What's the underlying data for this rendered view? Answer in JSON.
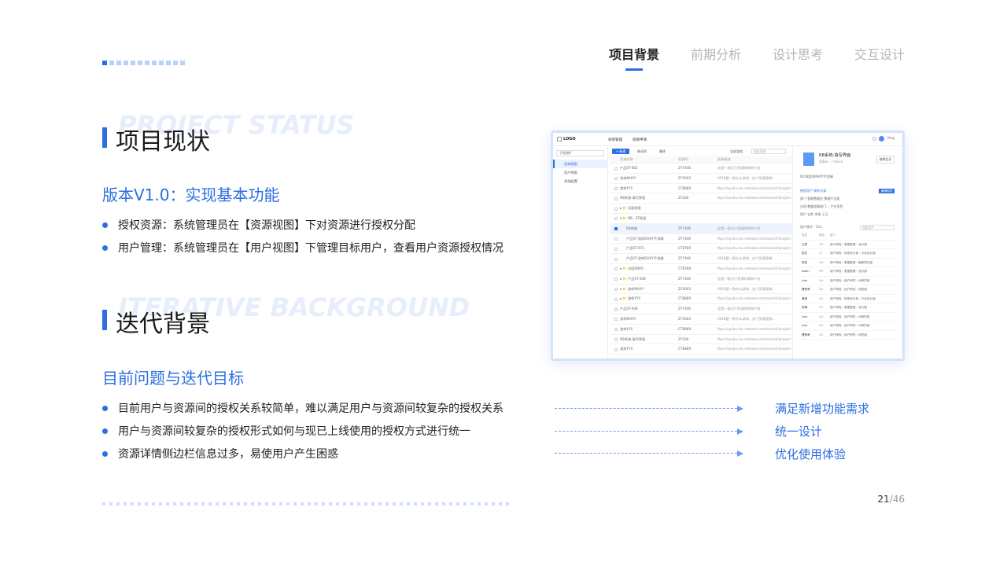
{
  "nav": {
    "items": [
      {
        "label": "项目背景",
        "active": true
      },
      {
        "label": "前期分析",
        "active": false
      },
      {
        "label": "设计思考",
        "active": false
      },
      {
        "label": "交互设计",
        "active": false
      }
    ]
  },
  "section1": {
    "title": "项目现状",
    "ghost": "PROJECT STATUS",
    "subtitle": "版本V1.0：实现基本功能",
    "bullets": [
      "授权资源：系统管理员在【资源视图】下对资源进行授权分配",
      "用户管理：系统管理员在【用户视图】下管理目标用户，查看用户资源授权情况"
    ]
  },
  "section2": {
    "title": "迭代背景",
    "ghost": "ITERATIVE BACKGROUND",
    "subtitle": "目前问题与迭代目标",
    "bullets": [
      "目前用户与资源间的授权关系较简单，难以满足用户与资源间较复杂的授权关系",
      "用户与资源间较复杂的授权形式如何与现已上线使用的授权方式进行统一",
      "资源详情侧边栏信息过多，易使用户产生困惑"
    ],
    "results": [
      "满足新增功能需求",
      "统一设计",
      "优化使用体验"
    ]
  },
  "pager": {
    "current": "21",
    "total": "/46"
  },
  "mock": {
    "logo": "LOGO",
    "tabs": [
      "权限管理",
      "权限申请"
    ],
    "user": "Ying",
    "side_select": "子系统B",
    "side_items": [
      "资源视图",
      "用户视图",
      "系统配置"
    ],
    "toolbar": {
      "new": "+ 新建",
      "move": "移动到",
      "delete": "删除",
      "filter": "全部游戏",
      "search": "搜索资源"
    },
    "table_head": [
      "资源名称",
      "资源ID",
      "资源描述"
    ],
    "rows": [
      [
        "产品ST-002",
        "ZY7446",
        "这是一段对于资源的简单介绍"
      ],
      [
        "游戏MHXY",
        "ZY3003",
        "0018是一款什么游戏，这个资源是做..."
      ],
      [
        "游戏YYS",
        "CT8889",
        "ftps://xyuhu.nie.netease.com/search?project"
      ],
      [
        "RB系统-填写界面",
        "ZY300",
        "ftps://xyuhu.nie.netease.com/search?project"
      ],
      [
        "▸ 📁 页面权限",
        "",
        ""
      ],
      [
        "▾ 📁 RB...ST框架",
        "",
        ""
      ],
      [
        "RB系统",
        "ZY7446",
        "这是一段对于资源的简单介绍"
      ],
      [
        "产品ST-游戏DHXY手游端",
        "ZY7446",
        "ftps://xyuhu.nie.netease.com/search?project"
      ],
      [
        "产品ST-073",
        "CT8789",
        "ftps://xyuhu.nie.netease.com/search?project"
      ],
      [
        "产品ST-游戏DHXY手游端",
        "ZY7446",
        "0018是一款什么游戏，这个资源是做..."
      ],
      [
        "▸ 📁 分组RBPG",
        "CT8789",
        "ftps://xyuhu.nie.netease.com/search?project"
      ],
      [
        "▸ 📁 产品ST-046",
        "ZY7446",
        "这是一段对于资源的简单介绍"
      ],
      [
        "▸ 📁 游戏MHXY",
        "ZY3003",
        "0018是一款什么游戏，这个资源是做..."
      ],
      [
        "▸ 📁 游戏YYS",
        "CT8889",
        "ftps://xyuhu.nie.netease.com/search?project"
      ],
      [
        "产品ST-046",
        "ZY7446",
        "这是一段对于资源的简单介绍"
      ],
      [
        "游戏MHXY",
        "ZY3003",
        "0018是一款什么游戏，这个资源是做..."
      ],
      [
        "游戏YYS",
        "CT8889",
        "ftps://xyuhu.nie.netease.com/search?project"
      ],
      [
        "RB系统-填写界面",
        "ZY300",
        "ftps://xyuhu.nie.netease.com/search?project"
      ],
      [
        "游戏YYS",
        "CT8889",
        "ftps://xyuhu.nie.netease.com/search?project"
      ]
    ],
    "detail": {
      "title": "RB系统-填写界面",
      "id": "资源ID：CT8876",
      "edit": "编辑信息",
      "game": "0018游戏MHXY手游端",
      "tabs": "授权用户   操作记录",
      "edit_perm": "编辑权限",
      "dept": "部门   智能数据业    数据产品组",
      "group": "分组   数据投服部门...  平台项目",
      "user": "用户   吉利    李青    王王",
      "count": "用户统计：53人",
      "search": "搜索用户",
      "head": [
        "姓名",
        "角色",
        "部门"
      ],
      "users": [
        [
          "王莉",
          "UX",
          "用户体验 › 数据投服 › 设计部"
        ],
        [
          "张红",
          "UI",
          "用户体验 › 研发设计部 › 平台设计组"
        ],
        [
          "张凯",
          "QU",
          "用户体验 › 数据投服 › 聚焦算法组"
        ],
        [
          "awen",
          "PM",
          "用户体验 › 数据投服 › 设计部"
        ],
        [
          "Lisa",
          "QU",
          "用户体验 › 用户研究 › AI研究组"
        ],
        [
          "曹莉莉",
          "QA",
          "用户体验 › 用户研究 › 研发组"
        ],
        [
          "黄琪",
          "QA",
          "用户体验 › 研发设计部 › 平台设计组"
        ],
        [
          "张琳",
          "QU",
          "用户体验 › 数据投服 › 设计部"
        ],
        [
          "Lisa",
          "QU",
          "用户体验 › 用户研究 › AI研究组"
        ],
        [
          "Lisa",
          "QU",
          "用户体验 › 用户研究 › AI研究组"
        ],
        [
          "曹莉莉",
          "QA",
          "用户体验 › 用户研究 › 研发组"
        ]
      ]
    }
  }
}
